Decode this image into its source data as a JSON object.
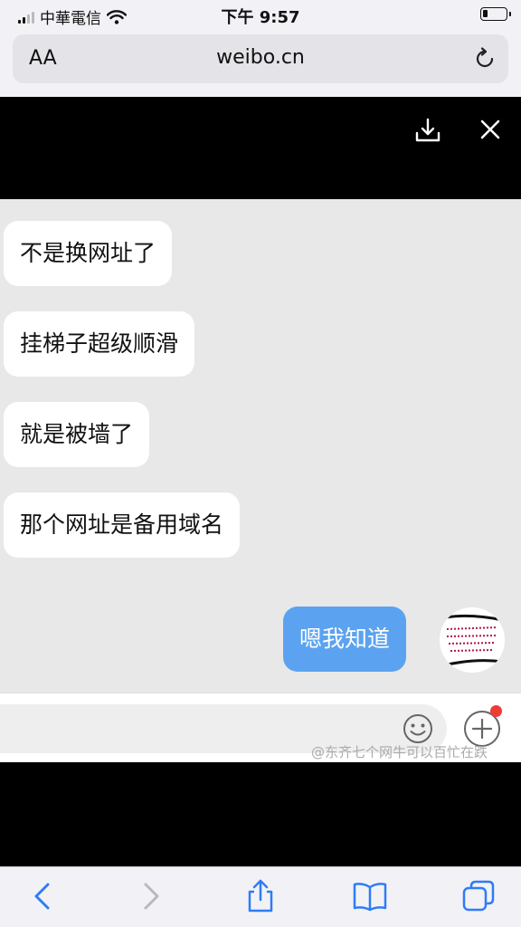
{
  "status_bar": {
    "carrier": "中華電信",
    "time": "下午 9:57"
  },
  "browser": {
    "text_size_label": "AA",
    "url": "weibo.cn"
  },
  "chat": {
    "messages": [
      {
        "side": "received",
        "text": "不是换网址了"
      },
      {
        "side": "received",
        "text": "挂梯子超级顺滑"
      },
      {
        "side": "received",
        "text": "就是被墙了"
      },
      {
        "side": "received",
        "text": "那个网址是备用域名"
      },
      {
        "side": "sent",
        "text": "嗯我知道"
      }
    ]
  },
  "input": {
    "watermark": "@东齐七个网牛可以百忙在跌"
  },
  "icons": {
    "signal": "cellular-signal-icon",
    "wifi": "wifi-icon",
    "battery": "battery-icon",
    "reload": "reload-icon",
    "download": "download-icon",
    "close": "close-icon",
    "emoji": "emoji-icon",
    "add": "plus-icon",
    "back": "back-chevron-icon",
    "forward": "forward-chevron-icon",
    "share": "share-icon",
    "bookmarks": "book-icon",
    "tabs": "tabs-icon"
  },
  "colors": {
    "sent_bubble": "#5ba3f0",
    "received_bubble": "#ffffff",
    "chat_background": "#e8e8e8",
    "ios_blue": "#2f7cf6",
    "notification_dot": "#ee3b34"
  }
}
